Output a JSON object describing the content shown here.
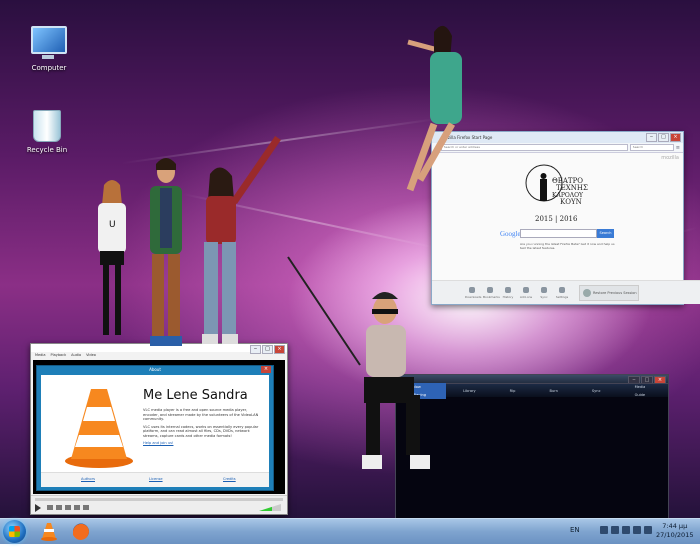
{
  "desktop": {
    "icons": [
      {
        "label": "Computer",
        "icon": "computer-icon"
      },
      {
        "label": "Recycle Bin",
        "icon": "recycle-bin-icon"
      }
    ]
  },
  "firefox": {
    "title": "Mozilla Firefox Start Page",
    "url_placeholder": "Search or enter address",
    "search_placeholder": "Search",
    "brand": "mozilla",
    "logo_text": [
      "ΘΕΑΤΡΟ",
      "ΤΕΧΝΗΣ",
      "ΚΑΡΟΛΟΥ",
      "ΚΟΥΝ"
    ],
    "years": "2015 | 2016",
    "google_label": "Google",
    "search_button": "Search",
    "note": "Are you running the latest Firefox Beta? Get it now and help us test the latest features.",
    "toolbar": [
      "Downloads",
      "Bookmarks",
      "History",
      "Add-ons",
      "Sync",
      "Settings"
    ],
    "restore": "Restore Previous Session"
  },
  "vlc": {
    "menu": [
      "Media",
      "Playback",
      "Audio",
      "Video"
    ],
    "about": {
      "title": "About",
      "heading": "Me Lene Sandra",
      "paragraph1": "VLC media player is a free and open source media player, encoder, and streamer made by the volunteers of the VideoLAN community.",
      "paragraph2": "VLC uses its internal codecs, works on essentially every popular platform, and can read almost all files, CDs, DVDs, network streams, capture cards and other media formats!",
      "link": "Help and join us!",
      "footer": [
        "Authors",
        "License",
        "Credits"
      ]
    }
  },
  "media_player": {
    "tabs": [
      "Now Playing",
      "Library",
      "Rip",
      "Burn",
      "Sync",
      "Media Guide"
    ]
  },
  "taskbar": {
    "language": "EN",
    "time": "7:44 μμ",
    "date": "27/10/2015"
  }
}
